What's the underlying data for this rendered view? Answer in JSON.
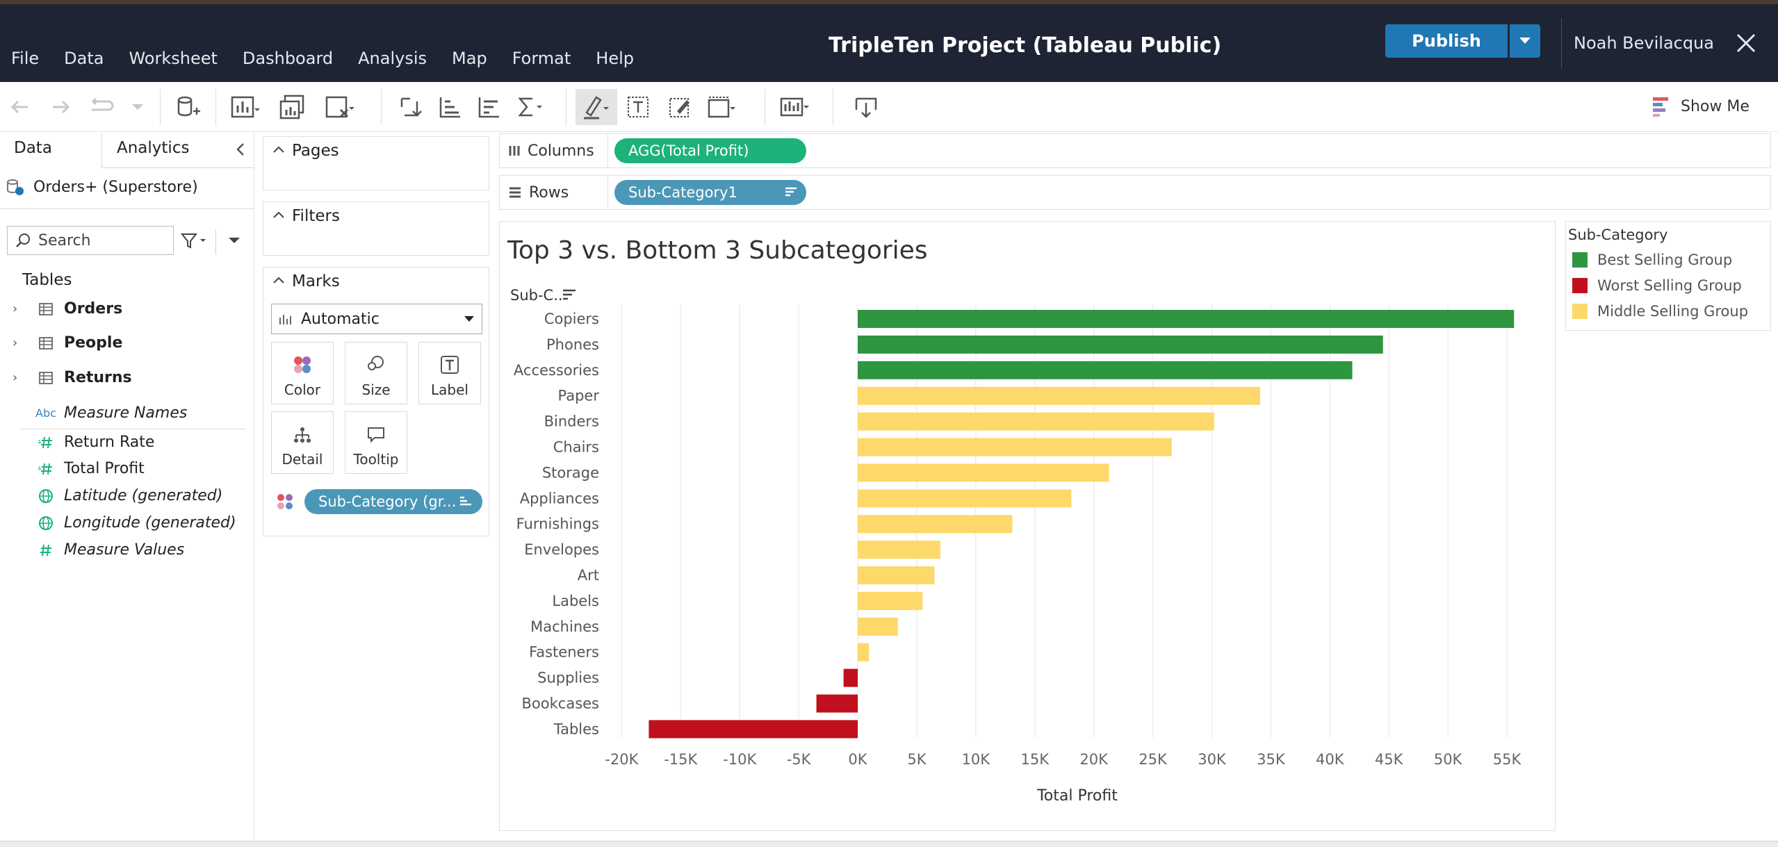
{
  "app": {
    "title": "TripleTen Project (Tableau Public)",
    "publish_label": "Publish",
    "user_name": "Noah Bevilacqua"
  },
  "menu": [
    "File",
    "Data",
    "Worksheet",
    "Dashboard",
    "Analysis",
    "Map",
    "Format",
    "Help"
  ],
  "toolbar": {
    "show_me_label": "Show Me"
  },
  "data_pane": {
    "tab_data": "Data",
    "tab_analytics": "Analytics",
    "datasource": "Orders+ (Superstore)",
    "search_placeholder": "Search",
    "tables_heading": "Tables",
    "tables": [
      "Orders",
      "People",
      "Returns"
    ],
    "measure_names": "Measure Names",
    "measure_names_icon": "Abc",
    "measures": [
      "Return Rate",
      "Total Profit"
    ],
    "generated": [
      "Latitude (generated)",
      "Longitude (generated)"
    ],
    "measure_values": "Measure Values"
  },
  "cards": {
    "pages_title": "Pages",
    "filters_title": "Filters",
    "marks_title": "Marks",
    "mark_type": "Automatic",
    "buttons": {
      "color": "Color",
      "size": "Size",
      "label": "Label",
      "detail": "Detail",
      "tooltip": "Tooltip"
    },
    "color_pill": "Sub-Category (gr..."
  },
  "shelves": {
    "columns_label": "Columns",
    "columns_pill": "AGG(Total Profit)",
    "rows_label": "Rows",
    "rows_pill": "Sub-Category1"
  },
  "chart_data": {
    "type": "bar",
    "orientation": "horizontal",
    "title": "Top 3 vs. Bottom 3 Subcategories",
    "ylabel": "Sub-C..",
    "xlabel": "Total Profit",
    "xlim": [
      -22000,
      57000
    ],
    "xticks": [
      -20000,
      -15000,
      -10000,
      -5000,
      0,
      5000,
      10000,
      15000,
      20000,
      25000,
      30000,
      35000,
      40000,
      45000,
      50000,
      55000
    ],
    "xtick_labels": [
      "-20K",
      "-15K",
      "-10K",
      "-5K",
      "0K",
      "5K",
      "10K",
      "15K",
      "20K",
      "25K",
      "30K",
      "35K",
      "40K",
      "45K",
      "50K",
      "55K"
    ],
    "categories": [
      "Copiers",
      "Phones",
      "Accessories",
      "Paper",
      "Binders",
      "Chairs",
      "Storage",
      "Appliances",
      "Furnishings",
      "Envelopes",
      "Art",
      "Labels",
      "Machines",
      "Fasteners",
      "Supplies",
      "Bookcases",
      "Tables"
    ],
    "values": [
      55600,
      44500,
      41900,
      34100,
      30200,
      26600,
      21300,
      18100,
      13100,
      7000,
      6500,
      5500,
      3400,
      950,
      -1200,
      -3500,
      -17700
    ],
    "groups": [
      "Best Selling Group",
      "Best Selling Group",
      "Best Selling Group",
      "Middle Selling Group",
      "Middle Selling Group",
      "Middle Selling Group",
      "Middle Selling Group",
      "Middle Selling Group",
      "Middle Selling Group",
      "Middle Selling Group",
      "Middle Selling Group",
      "Middle Selling Group",
      "Middle Selling Group",
      "Middle Selling Group",
      "Worst Selling Group",
      "Worst Selling Group",
      "Worst Selling Group"
    ],
    "legend_title": "Sub-Category",
    "legend": [
      {
        "name": "Best Selling Group",
        "color": "#2e9541"
      },
      {
        "name": "Worst Selling Group",
        "color": "#c0101d"
      },
      {
        "name": "Middle Selling Group",
        "color": "#fcd96a"
      }
    ],
    "grid": true,
    "legend_position": "right"
  }
}
